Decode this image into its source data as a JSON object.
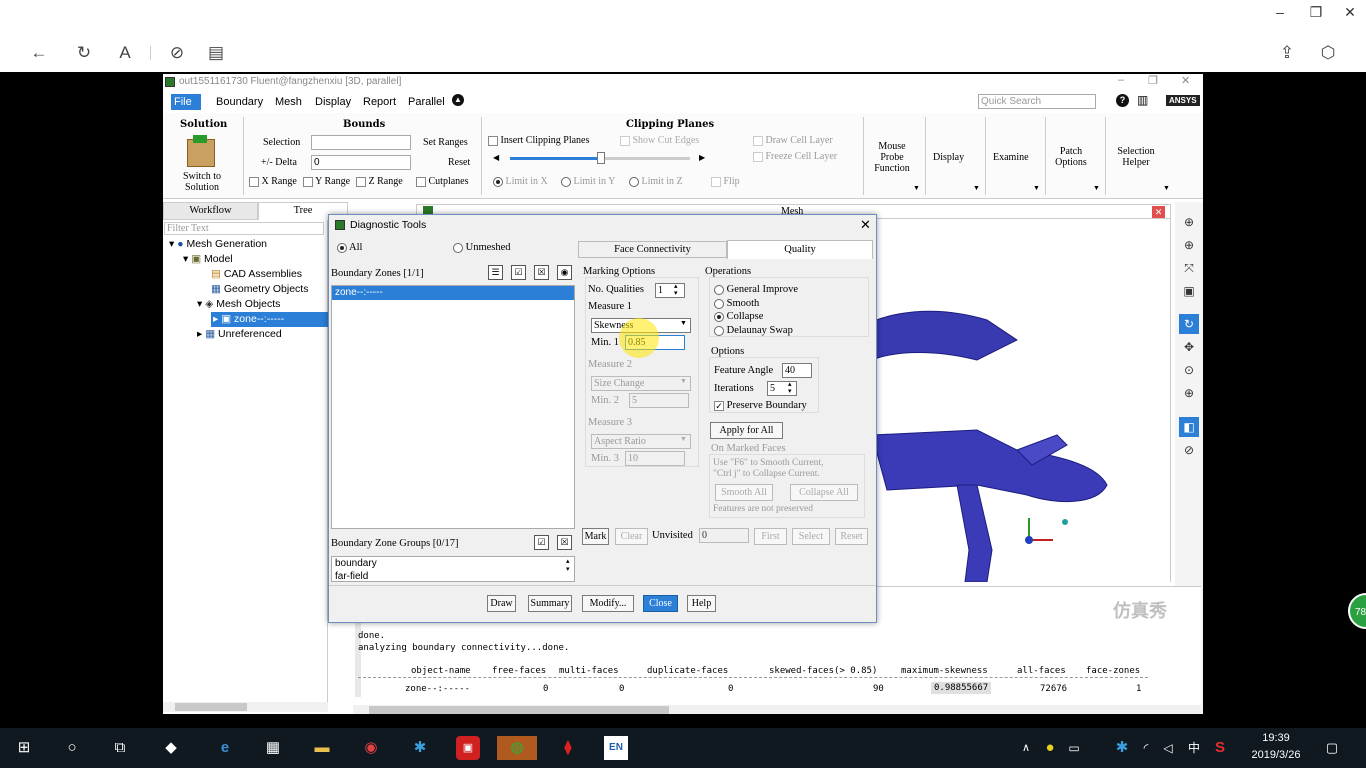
{
  "browser": {
    "window_controls": [
      "–",
      "❐",
      "✕"
    ],
    "nav_icons": [
      "←",
      "↻",
      "A",
      "⊘",
      "▤"
    ],
    "right_icons": [
      "⇪",
      "⬡"
    ]
  },
  "fluent": {
    "title": "out1551161730 Fluent@fangzhenxiu  [3D, parallel]",
    "menu": [
      "File",
      "Boundary",
      "Mesh",
      "Display",
      "Report",
      "Parallel"
    ],
    "quick_search_placeholder": "Quick Search",
    "brand": "ANSYS"
  },
  "ribbon": {
    "solution_header": "Solution",
    "switch_label": "Switch to\nSolution",
    "bounds_header": "Bounds",
    "selection_label": "Selection",
    "delta_label": "+/- Delta",
    "delta_value": "0",
    "set_ranges": "Set Ranges",
    "reset": "Reset",
    "x_range": "X Range",
    "y_range": "Y Range",
    "z_range": "Z Range",
    "cutplanes": "Cutplanes",
    "clipping_header": "Clipping Planes",
    "insert_clipping": "Insert Clipping Planes",
    "show_cut_edges": "Show Cut Edges",
    "limit_x": "Limit in X",
    "limit_y": "Limit in Y",
    "limit_z": "Limit in Z",
    "flip": "Flip",
    "draw_cell_layer": "Draw Cell Layer",
    "freeze_cell_layer": "Freeze Cell Layer",
    "mouse_probe": "Mouse\nProbe\nFunction",
    "display": "Display",
    "examine": "Examine",
    "patch_options": "Patch\nOptions",
    "selection_helper": "Selection\nHelper"
  },
  "tree": {
    "tabs": [
      "Workflow",
      "Tree"
    ],
    "filter_placeholder": "Filter Text",
    "items": [
      {
        "label": "Mesh Generation",
        "level": 0
      },
      {
        "label": "Model",
        "level": 1
      },
      {
        "label": "CAD Assemblies",
        "level": 2
      },
      {
        "label": "Geometry Objects",
        "level": 2
      },
      {
        "label": "Mesh Objects",
        "level": 2
      },
      {
        "label": "zone--:-----",
        "level": 3
      },
      {
        "label": "Unreferenced",
        "level": 2
      }
    ]
  },
  "graphics": {
    "title": "Mesh",
    "watermark": "仿真秀"
  },
  "dialog": {
    "title": "Diagnostic Tools",
    "filter_all": "All",
    "filter_unmeshed": "Unmeshed",
    "boundary_zones_label": "Boundary Zones [1/1]",
    "boundary_zones": [
      "zone--:-----"
    ],
    "boundary_zone_groups_label": "Boundary Zone Groups [0/17]",
    "boundary_zone_groups": [
      "boundary",
      "far-field"
    ],
    "tabs": [
      "Face Connectivity",
      "Quality"
    ],
    "marking_options": "Marking Options",
    "no_qualities_label": "No. Qualities",
    "no_qualities_value": "1",
    "measure1_label": "Measure 1",
    "measure1_value": "Skewness",
    "min1_label": "Min. 1",
    "min1_value": "0.85",
    "measure2_label": "Measure 2",
    "measure2_value": "Size Change",
    "min2_label": "Min. 2",
    "min2_value": "5",
    "measure3_label": "Measure 3",
    "measure3_value": "Aspect Ratio",
    "min3_label": "Min. 3",
    "min3_value": "10",
    "operations_label": "Operations",
    "operations": [
      "General Improve",
      "Smooth",
      "Collapse",
      "Delaunay Swap"
    ],
    "options_label": "Options",
    "feature_angle_label": "Feature Angle",
    "feature_angle_value": "40",
    "iterations_label": "Iterations",
    "iterations_value": "5",
    "preserve_boundary": "Preserve Boundary",
    "apply_for_all": "Apply for All",
    "on_marked_faces": "On Marked Faces",
    "hint": "Use \"F6\" to Smooth Current,\n\"Ctrl j\" to Collapse Current.",
    "smooth_all": "Smooth All",
    "collapse_all": "Collapse All",
    "features_note": "Features are not preserved",
    "mark": "Mark",
    "clear": "Clear",
    "unvisited_label": "Unvisited",
    "unvisited_value": "0",
    "first": "First",
    "select": "Select",
    "reset": "Reset",
    "buttons": [
      "Draw",
      "Summary",
      "Modify...",
      "Close",
      "Help"
    ]
  },
  "console": {
    "lines": [
      "done.",
      "analyzing boundary connectivity...done."
    ],
    "headers": [
      "object-name",
      "free-faces",
      "multi-faces",
      "duplicate-faces",
      "skewed-faces(> 0.85)",
      "maximum-skewness",
      "all-faces",
      "face-zones"
    ],
    "row": [
      "zone--:-----",
      "0",
      "0",
      "0",
      "90",
      "0.98855667",
      "72676",
      "1"
    ]
  },
  "taskbar": {
    "time": "19:39",
    "date": "2019/3/26",
    "ime": "中",
    "badge": "78"
  }
}
